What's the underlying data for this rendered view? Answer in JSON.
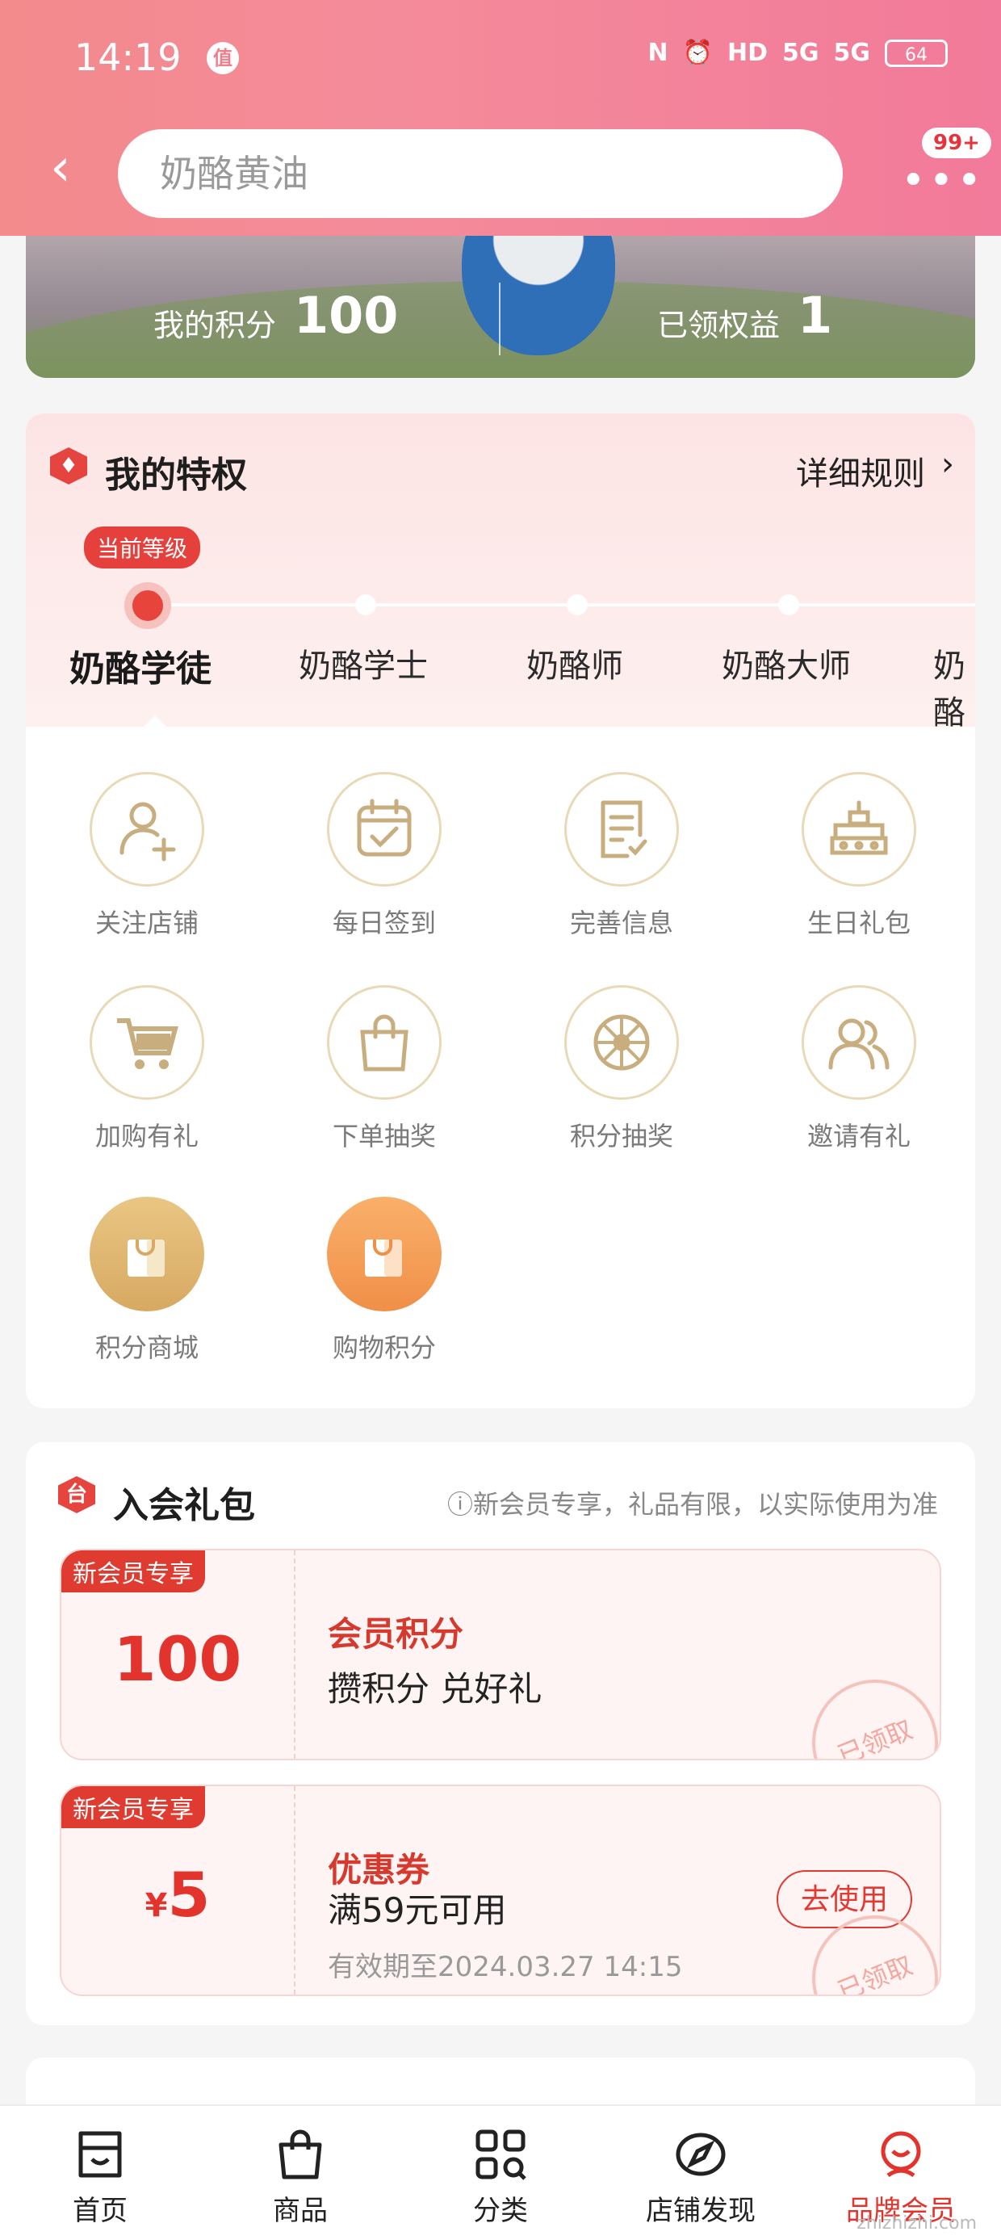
{
  "status_bar": {
    "time": "14:19",
    "badge": "值",
    "icons": [
      "N",
      "⏰",
      "HD",
      "5G",
      "5G"
    ],
    "battery": "64"
  },
  "header": {
    "back_icon": "‹",
    "search_placeholder": "奶酪黄油",
    "more_icon": "•••",
    "more_badge": "99+"
  },
  "banner": {
    "points_label": "我的积分",
    "points_value": "100",
    "benefits_label": "已领权益",
    "benefits_value": "1"
  },
  "privileges": {
    "icon": "♦",
    "title": "我的特权",
    "rules_label": "详细规则",
    "chevron": "›",
    "current_tag": "当前等级",
    "levels": [
      "奶酪学徒",
      "奶酪学士",
      "奶酪师",
      "奶酪大师",
      "奶酪"
    ],
    "items": [
      {
        "label": "关注店铺",
        "icon": "add-user-icon"
      },
      {
        "label": "每日签到",
        "icon": "calendar-check-icon"
      },
      {
        "label": "完善信息",
        "icon": "document-edit-icon"
      },
      {
        "label": "生日礼包",
        "icon": "birthday-cake-icon"
      },
      {
        "label": "加购有礼",
        "icon": "shopping-cart-icon"
      },
      {
        "label": "下单抽奖",
        "icon": "shopping-bag-icon"
      },
      {
        "label": "积分抽奖",
        "icon": "lottery-wheel-icon"
      },
      {
        "label": "邀请有礼",
        "icon": "invite-users-icon"
      },
      {
        "label": "积分商城",
        "icon": "points-mall-icon"
      },
      {
        "label": "购物积分",
        "icon": "shopping-points-icon"
      }
    ]
  },
  "gift": {
    "icon": "台",
    "title": "入会礼包",
    "note": "ⓘ新会员专享，礼品有限，以实际使用为准",
    "coupons": [
      {
        "tag": "新会员专享",
        "value": "100",
        "title": "会员积分",
        "subtitle": "攒积分 兑好礼",
        "stamp": "已领取"
      },
      {
        "tag": "新会员专享",
        "value_prefix": "¥",
        "value": "5",
        "title": "优惠券",
        "subtitle": "满59元可用",
        "date": "有效期至2024.03.27 14:15",
        "button": "去使用",
        "stamp": "已领取"
      }
    ]
  },
  "bottom_nav": [
    {
      "label": "首页",
      "icon": "shop-home-icon"
    },
    {
      "label": "商品",
      "icon": "bag-icon"
    },
    {
      "label": "分类",
      "icon": "category-grid-icon"
    },
    {
      "label": "店铺发现",
      "icon": "compass-icon"
    },
    {
      "label": "品牌会员",
      "icon": "member-icon",
      "active": true
    }
  ],
  "watermark": "zhizhizhi.com",
  "colors": {
    "accent": "#e2342c",
    "header_pink": "#f48b9a",
    "gold": "#c8ad7f"
  }
}
